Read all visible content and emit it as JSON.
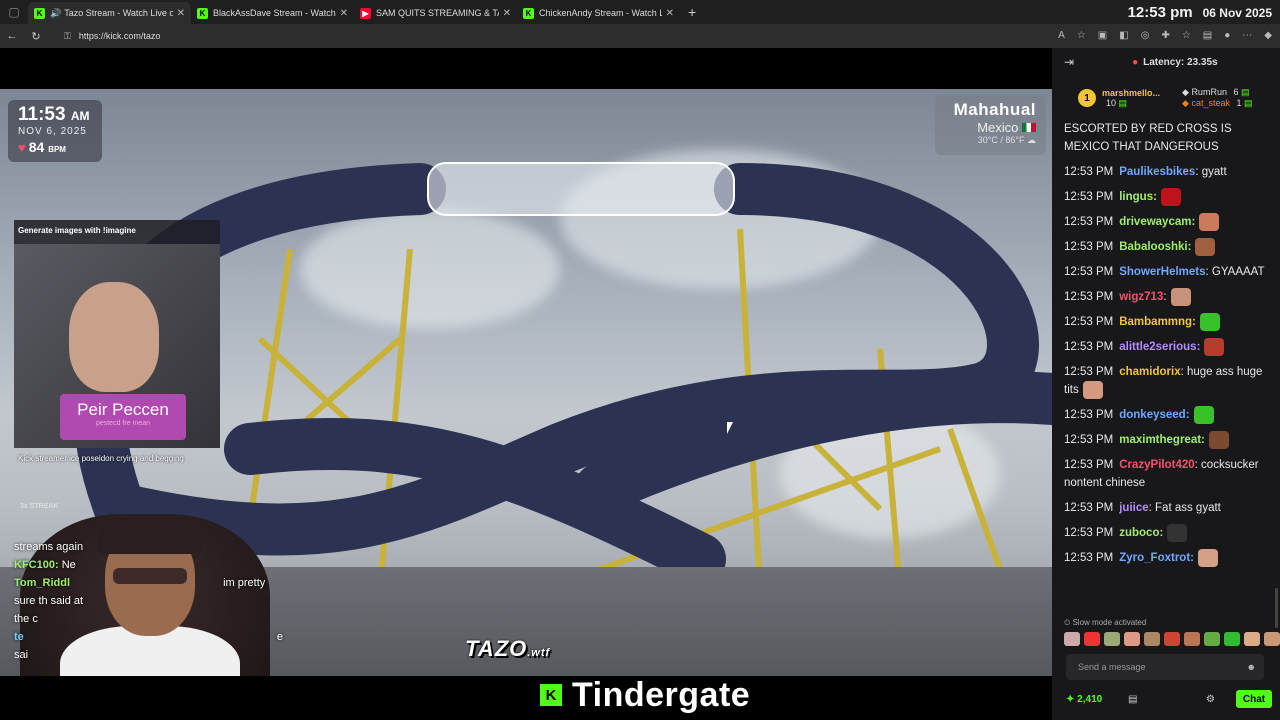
{
  "browser": {
    "tabs": [
      {
        "title": "Tazo Stream - Watch Live on",
        "favicon": "kick",
        "color": "#53fc18",
        "active": true,
        "speaker": true
      },
      {
        "title": "BlackAssDave Stream - Watch Live",
        "favicon": "kick",
        "color": "#53fc18",
        "active": false
      },
      {
        "title": "SAM QUITS STREAMING & TAXES",
        "favicon": "youtube",
        "color": "#ff0033",
        "active": false
      },
      {
        "title": "ChickenAndy Stream - Watch Live",
        "favicon": "kick",
        "color": "#53fc18",
        "active": false
      }
    ],
    "url": "https://kick.com/tazo",
    "clock_time": "12:53 pm",
    "clock_date": "06 Nov 2025"
  },
  "stream": {
    "overlay_time": "11:53",
    "overlay_ampm": "AM",
    "overlay_date": "NOV 6, 2025",
    "bpm_value": "84",
    "bpm_unit": "BPM",
    "location_city": "Mahahual",
    "location_country": "Mexico",
    "weather": "30°C / 86°F",
    "generate_prompt": "Generate images with !imagine",
    "generated_sign_big": "Peir Peccen",
    "generated_sign_small": "pestecd fre mean",
    "generated_caption": "Kick streamer ice poseidon crying and begging",
    "streak": "3x STREAK",
    "overlay_chat": [
      {
        "user": "",
        "text": "streams again"
      },
      {
        "user": "KFC100:",
        "text": "Ne"
      },
      {
        "user": "Tom_Riddl",
        "text": "im pretty"
      },
      {
        "user": "",
        "text": "sure th        said at"
      },
      {
        "user": "",
        "text": "the c"
      },
      {
        "user": "te",
        "text": "e"
      },
      {
        "user": "",
        "text": "sai"
      }
    ],
    "brand_text": "TAZO",
    "brand_suffix": ".wtf",
    "kick_logo": "K",
    "title": "Tindergate"
  },
  "chat": {
    "latency": "Latency: 23.35s",
    "pinned": {
      "rank": "1",
      "user1": "marshmello...",
      "user1_count": "10",
      "user2": "RumRun",
      "user2_count": "6",
      "user3": "cat_steak",
      "user3_count": "1"
    },
    "messages": [
      {
        "time": "",
        "user": "",
        "color": "#e8e8e8",
        "text": "ESCORTED BY RED CROSS IS MEXICO THAT DANGEROUS",
        "emote": ""
      },
      {
        "time": "12:53 PM",
        "user": "Paulikesbikes",
        "color": "#6fa8ff",
        "text": ": gyatt",
        "emote": ""
      },
      {
        "time": "12:53 PM",
        "user": "lingus:",
        "color": "#9fef6a",
        "text": "",
        "emote": "#c0121a"
      },
      {
        "time": "12:53 PM",
        "user": "drivewaycam:",
        "color": "#9fef6a",
        "text": "",
        "emote": "#c97b5c"
      },
      {
        "time": "12:53 PM",
        "user": "Babalooshki:",
        "color": "#9fef6a",
        "text": "",
        "emote": "#a0603e"
      },
      {
        "time": "12:53 PM",
        "user": "ShowerHelmets",
        "color": "#6fa8ff",
        "text": ": GYAAAAT",
        "emote": ""
      },
      {
        "time": "12:53 PM",
        "user": "wigz713",
        "color": "#ff4d6a",
        "text": ":",
        "emote": "#c8917a"
      },
      {
        "time": "12:53 PM",
        "user": "Bambammng:",
        "color": "#f3c534",
        "text": "",
        "emote": "#39c12a"
      },
      {
        "time": "12:53 PM",
        "user": "alittle2serious:",
        "color": "#b58cff",
        "text": "",
        "emote": "#b63c2c"
      },
      {
        "time": "12:53 PM",
        "user": "chamidorix",
        "color": "#f3c534",
        "text": ": huge ass huge tits",
        "emote": "#d49a80"
      },
      {
        "time": "12:53 PM",
        "user": "donkeyseed:",
        "color": "#6fa8ff",
        "text": "",
        "emote": "#39c12a"
      },
      {
        "time": "12:53 PM",
        "user": "maximthegreat:",
        "color": "#9fef6a",
        "text": "",
        "emote": "#7a4a32"
      },
      {
        "time": "12:53 PM",
        "user": "CrazyPilot420",
        "color": "#ff4d6a",
        "text": ": cocksucker nontent chinese",
        "emote": ""
      },
      {
        "time": "12:53 PM",
        "user": "juiice",
        "color": "#b58cff",
        "text": ": Fat ass gyatt",
        "emote": ""
      },
      {
        "time": "12:53 PM",
        "user": "zuboco:",
        "color": "#9fef6a",
        "text": "",
        "emote": "#333333"
      },
      {
        "time": "12:53 PM",
        "user": "Zyro_Foxtrot:",
        "color": "#6fa8ff",
        "text": "",
        "emote": "#d4a088"
      }
    ],
    "slow_mode": "Slow mode activated",
    "input_placeholder": "Send a message",
    "points": "2,410",
    "send_label": "Chat"
  }
}
